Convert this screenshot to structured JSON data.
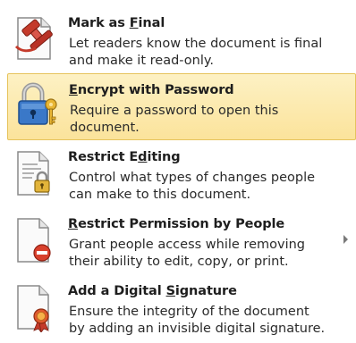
{
  "items": [
    {
      "name": "mark-as-final",
      "title_pre": "Mark as ",
      "title_key": "F",
      "title_post": "inal",
      "desc1": "Let readers know the document is final",
      "desc2": "and make it read-only.",
      "icon": "document-stamp-icon"
    },
    {
      "name": "encrypt-with-password",
      "title_pre": "",
      "title_key": "E",
      "title_post": "ncrypt with Password",
      "desc1": "Require a password to open this",
      "desc2": "document.",
      "icon": "padlock-key-icon"
    },
    {
      "name": "restrict-editing",
      "title_pre": "Restrict E",
      "title_key": "d",
      "title_post": "iting",
      "desc1": "Control what types of changes people",
      "desc2": "can make to this document.",
      "icon": "document-lock-icon"
    },
    {
      "name": "restrict-permission",
      "title_pre": "",
      "title_key": "R",
      "title_post": "estrict Permission by People",
      "desc1": "Grant people access while removing",
      "desc2": "their ability to edit, copy, or print.",
      "icon": "document-no-entry-icon"
    },
    {
      "name": "digital-signature",
      "title_pre": "Add a Digital ",
      "title_key": "S",
      "title_post": "ignature",
      "desc1": "Ensure the integrity of the document",
      "desc2": "by adding an invisible digital signature.",
      "icon": "document-ribbon-icon"
    }
  ],
  "submenu_indicator": "chevron-right-icon"
}
